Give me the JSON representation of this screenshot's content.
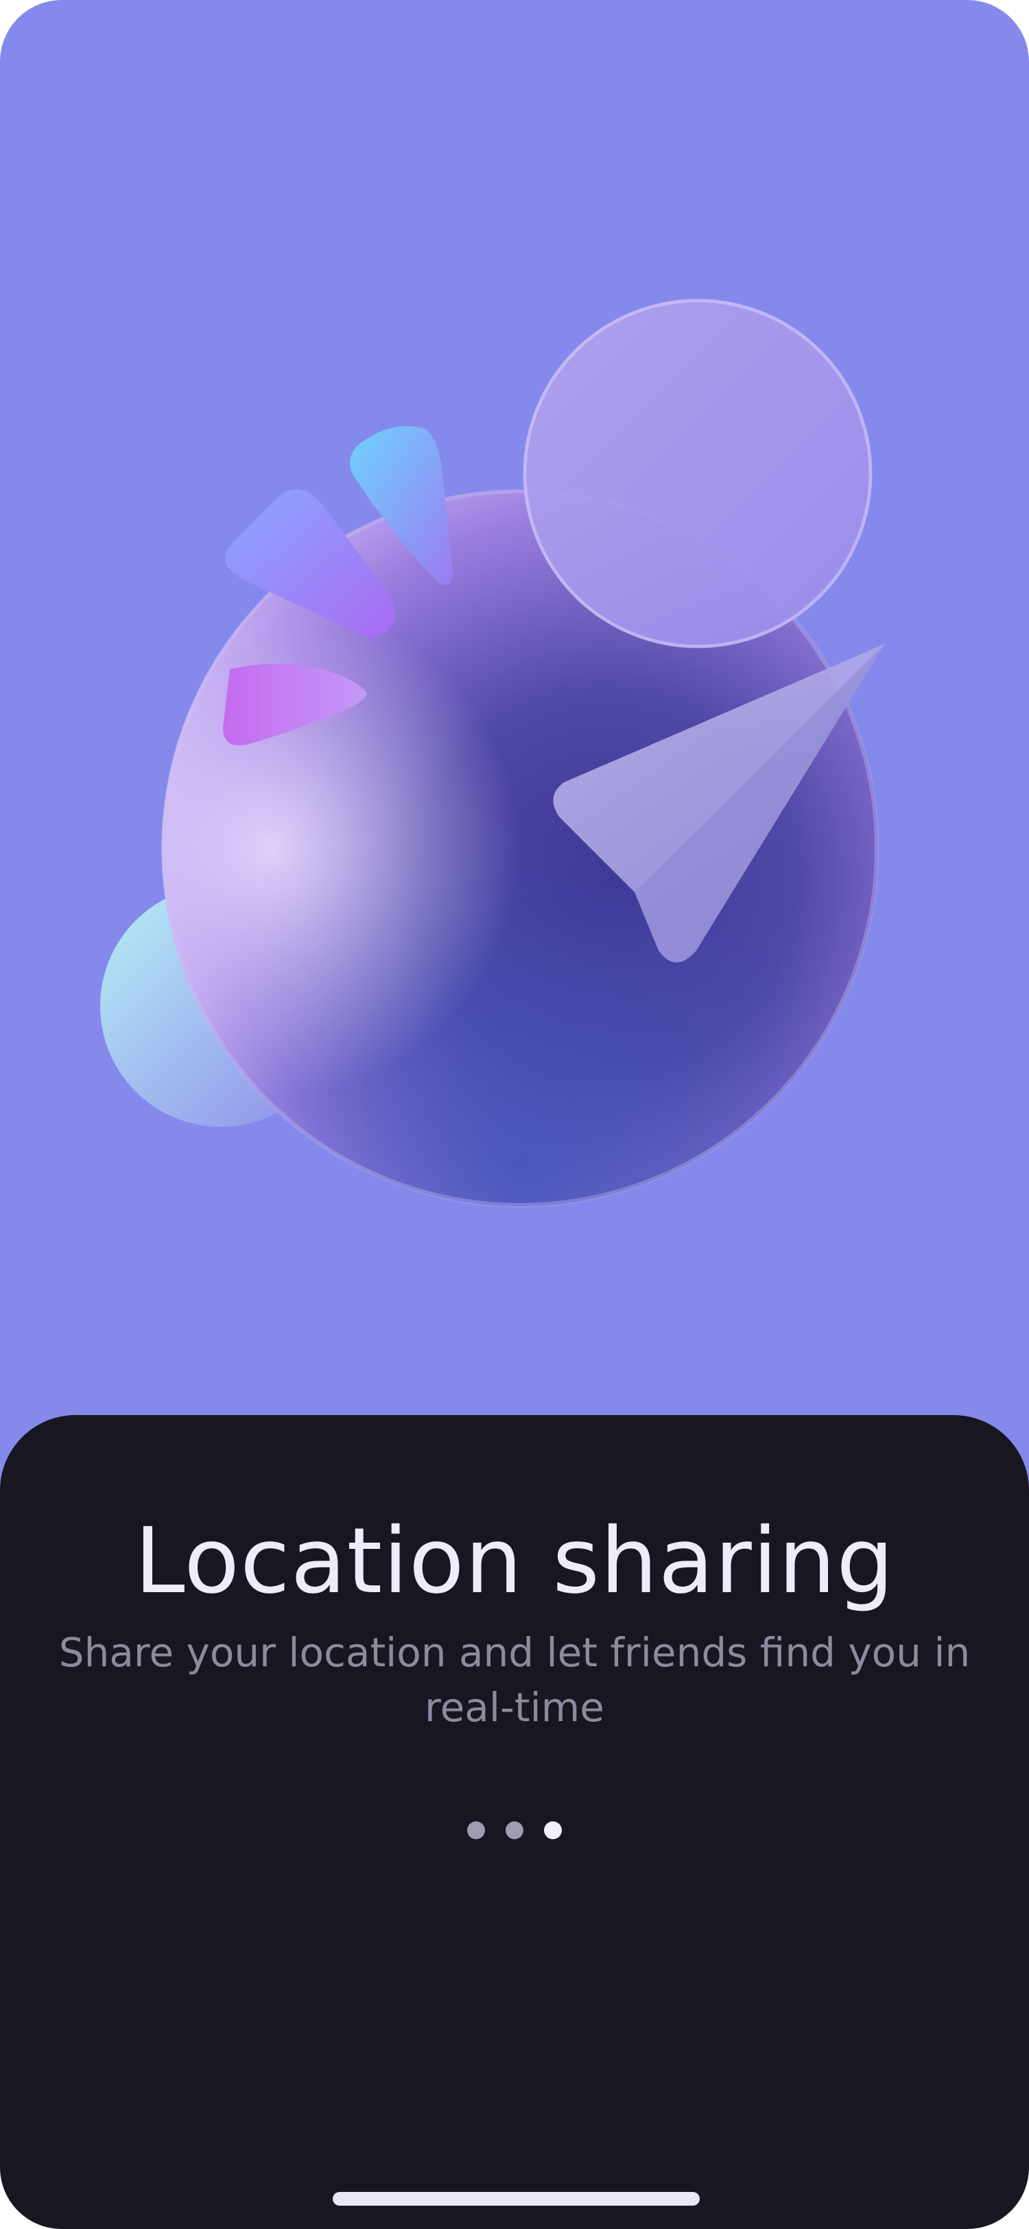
{
  "onboarding": {
    "title": "Location sharing",
    "subtitle": "Share your location and let friends find you in real-time",
    "page_indicator": {
      "total": 3,
      "active_index": 2
    }
  },
  "illustration": {
    "icon": "location-sharing-illustration"
  },
  "colors": {
    "background": "#8589EC",
    "sheet": "#171621",
    "title": "#EEEBFB",
    "subtitle": "#8D8A9E",
    "dot_inactive": "#9E9BB5",
    "dot_active": "#F2F0FF",
    "home_indicator": "#E9E6F7"
  }
}
